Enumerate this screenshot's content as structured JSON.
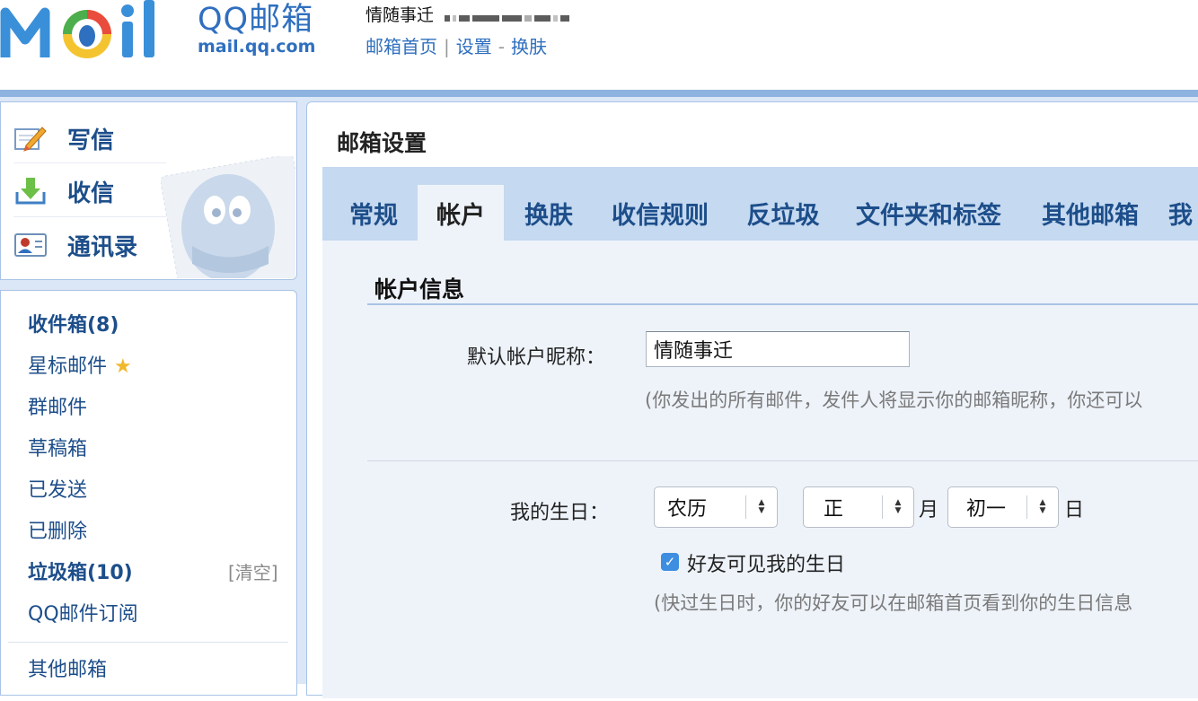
{
  "header": {
    "logo_mark": "Mail",
    "brand": "QQ邮箱",
    "domain": "mail.qq.com",
    "user_name": "情随事迁",
    "links": {
      "home": "邮箱首页",
      "settings": "设置",
      "dash": "-",
      "skin": "换肤"
    }
  },
  "sidebar": {
    "actions": [
      {
        "label": "写信",
        "icon": "compose-icon"
      },
      {
        "label": "收信",
        "icon": "inbox-download-icon"
      },
      {
        "label": "通讯录",
        "icon": "contacts-card-icon"
      }
    ],
    "folders": {
      "inbox": "收件箱(8)",
      "starred": "星标邮件",
      "group": "群邮件",
      "drafts": "草稿箱",
      "sent": "已发送",
      "deleted": "已删除",
      "spam": "垃圾箱(10)",
      "clear": "[清空]",
      "subscriptions": "QQ邮件订阅",
      "other": "其他邮箱"
    }
  },
  "main": {
    "title": "邮箱设置",
    "tabs": [
      "常规",
      "帐户",
      "换肤",
      "收信规则",
      "反垃圾",
      "文件夹和标签",
      "其他邮箱",
      "我"
    ],
    "active_tab": "帐户",
    "account": {
      "section_title": "帐户信息",
      "nickname_label": "默认帐户昵称：",
      "nickname_value": "情随事迁",
      "nickname_hint": "(你发出的所有邮件，发件人将显示你的邮箱昵称，你还可以",
      "birthday_label": "我的生日：",
      "calendar_type": "农历",
      "month_value": "正",
      "month_unit": "月",
      "day_value": "初一",
      "day_unit": "日",
      "visible_label": "好友可见我的生日",
      "visible_checked": true,
      "birthday_hint": "(快过生日时，你的好友可以在邮箱首页看到你的生日信息"
    }
  },
  "colors": {
    "brand_blue": "#2f6fbf",
    "link_blue": "#1d4e8a",
    "tab_bar": "#c5d9f0",
    "content_bg": "#eef3fa",
    "checkbox": "#3d8ee0"
  }
}
